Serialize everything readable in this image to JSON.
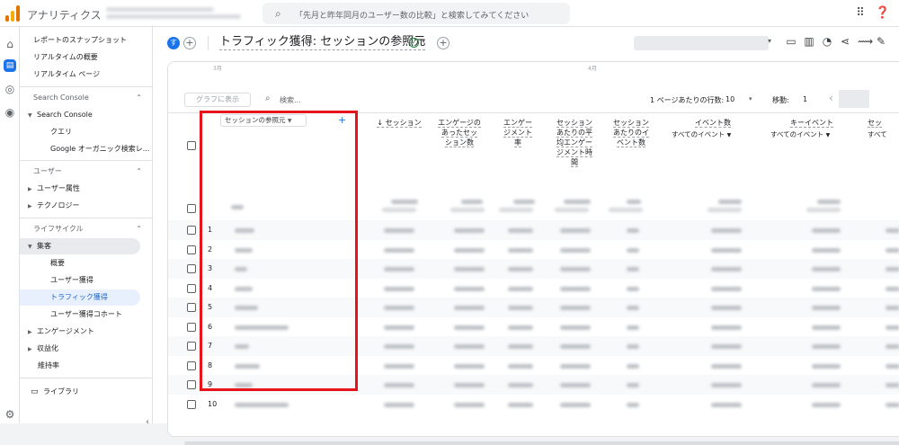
{
  "app": {
    "title": "アナリティクス"
  },
  "search": {
    "placeholder": "「先月と昨年同月のユーザー数の比較」と検索してみてください"
  },
  "top_icons": [
    "apps-grid-icon",
    "help-icon"
  ],
  "sidebar": {
    "items": [
      {
        "label": "レポートのスナップショット"
      },
      {
        "label": "リアルタイムの概要"
      },
      {
        "label": "リアルタイム ページ"
      },
      {
        "label": "Search Console"
      },
      {
        "label": "Search Console"
      },
      {
        "label": "クエリ"
      },
      {
        "label": "Google オーガニック検索レ..."
      },
      {
        "label": "ユーザー"
      },
      {
        "label": "ユーザー属性"
      },
      {
        "label": "テクノロジー"
      },
      {
        "label": "ライフサイクル"
      },
      {
        "label": "集客"
      },
      {
        "label": "概要"
      },
      {
        "label": "ユーザー獲得"
      },
      {
        "label": "トラフィック獲得"
      },
      {
        "label": "ユーザー獲得コホート"
      },
      {
        "label": "エンゲージメント"
      },
      {
        "label": "収益化"
      },
      {
        "label": "維持率"
      },
      {
        "label": "ライブラリ"
      }
    ]
  },
  "report": {
    "avatar_letter": "す",
    "title": "トラフィック獲得: セッションの参照元"
  },
  "chart_ticks": [
    "3月",
    "4月"
  ],
  "toolbar": {
    "graph_button": "グラフに表示",
    "search_placeholder": "検索...",
    "rows_label": "1 ページあたりの行数:",
    "rows_value": "10",
    "move_label": "移動:",
    "move_value": "1"
  },
  "table": {
    "dimension": "セッションの参照元",
    "headers": [
      {
        "label": "↓ セッション"
      },
      {
        "label": "エンゲージの\nあったセッ\nション数"
      },
      {
        "label": "エンゲー\nジメント\n率"
      },
      {
        "label": "セッション\nあたりの平\n均エンゲー\nジメント時\n間"
      },
      {
        "label": "セッション\nあたりのイ\nベント数"
      },
      {
        "label": "イベント数",
        "sub": "すべてのイベント"
      },
      {
        "label": "キーイベント",
        "sub": "すべてのイベント"
      },
      {
        "label": "セッ",
        "sub": "すべて"
      }
    ],
    "row_numbers": [
      "1",
      "2",
      "3",
      "4",
      "5",
      "6",
      "7",
      "8",
      "9",
      "10"
    ]
  },
  "colors": {
    "accent": "#1a73e8",
    "highlight_box": "#e8141b"
  }
}
